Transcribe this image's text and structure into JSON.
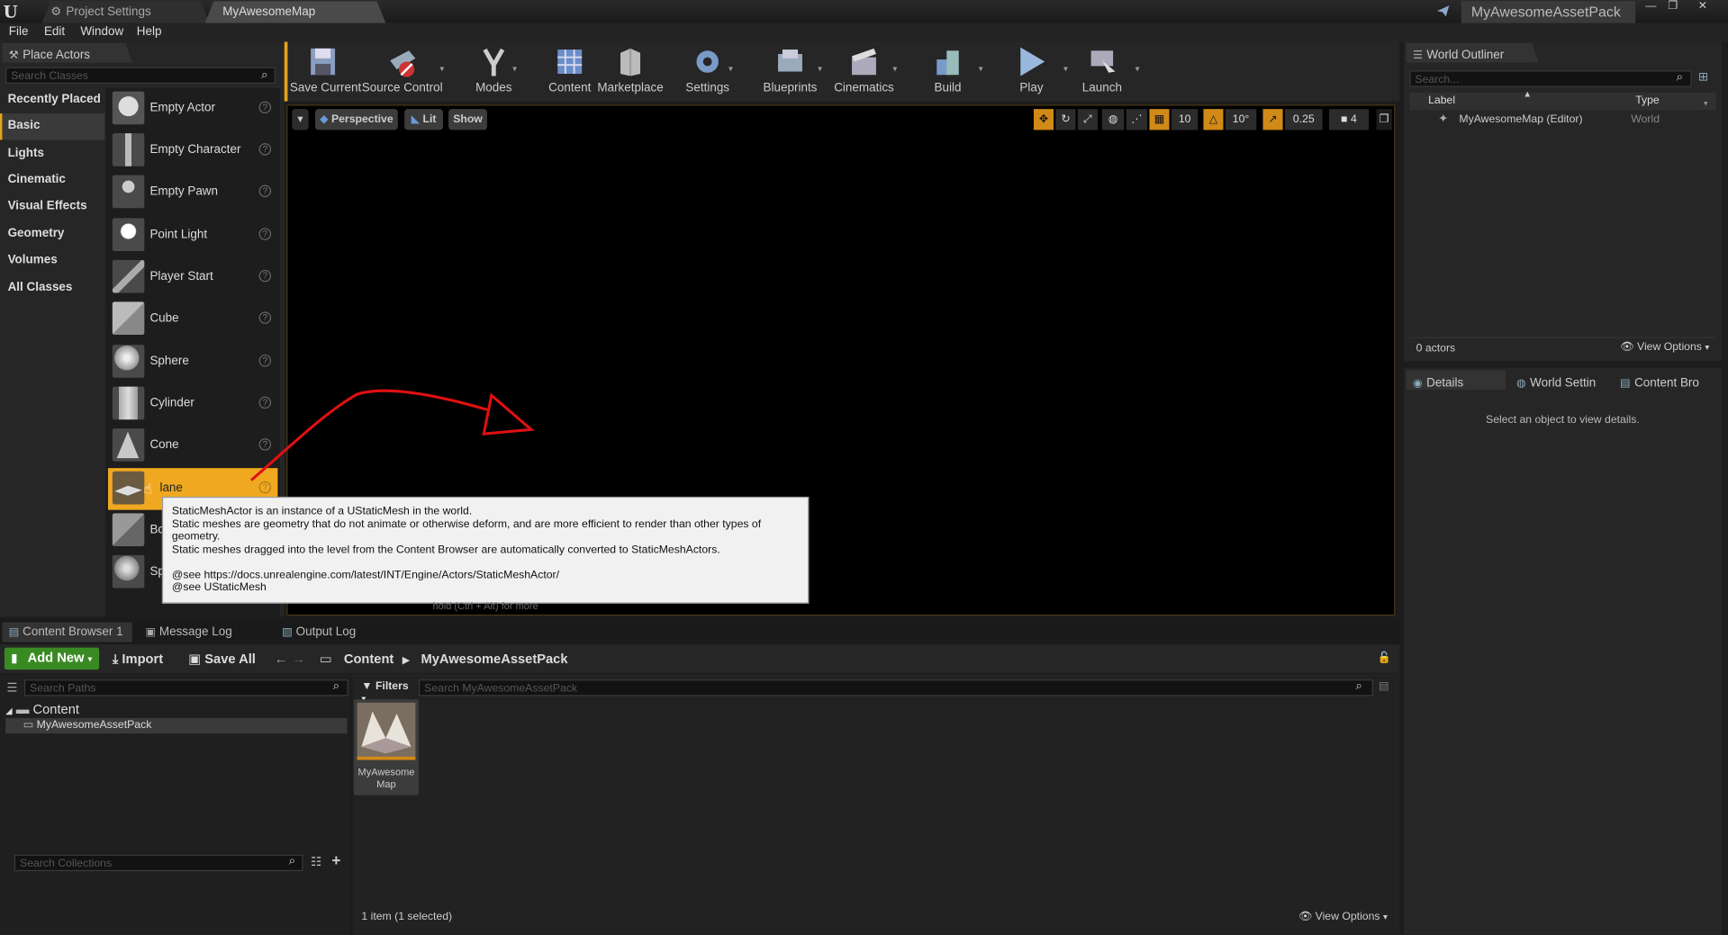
{
  "window": {
    "tabs": [
      "Project Settings",
      "MyAwesomeMap"
    ],
    "app_title": "MyAwesomeAssetPack",
    "controls": [
      "minimize",
      "restore",
      "close"
    ]
  },
  "menu": [
    "File",
    "Edit",
    "Window",
    "Help"
  ],
  "place_actors": {
    "tab_label": "Place Actors",
    "search_placeholder": "Search Classes",
    "categories": [
      "Recently Placed",
      "Basic",
      "Lights",
      "Cinematic",
      "Visual Effects",
      "Geometry",
      "Volumes",
      "All Classes"
    ],
    "selected_category": "Basic",
    "items": [
      "Empty Actor",
      "Empty Character",
      "Empty Pawn",
      "Point Light",
      "Player Start",
      "Cube",
      "Sphere",
      "Cylinder",
      "Cone",
      "Plane",
      "Box Trigger",
      "Sphere Trigger"
    ],
    "hovered_item": "Plane",
    "visible_labels": [
      "Empty Actor",
      "Empty Character",
      "Empty Pawn",
      "Point Light",
      "Player Start",
      "Cube",
      "Sphere",
      "Cylinder",
      "Cone",
      "lane",
      "Bo",
      "Sp"
    ]
  },
  "toolbar": {
    "buttons": [
      "Save Current",
      "Source Control",
      "Modes",
      "Content",
      "Marketplace",
      "Settings",
      "Blueprints",
      "Cinematics",
      "Build",
      "Play",
      "Launch"
    ]
  },
  "viewport": {
    "perspective": "Perspective",
    "lit": "Lit",
    "show": "Show",
    "grid_snap": "10",
    "rotation_snap": "10°",
    "scale_snap": "0.25",
    "camera_speed": "4",
    "annotation_color": "#e01010"
  },
  "tooltip": {
    "lines": [
      "StaticMeshActor is an instance of a UStaticMesh in the world.",
      "Static meshes are geometry that do not animate or otherwise deform, and are more efficient to render than other types of geometry.",
      "Static meshes dragged into the level from the Content Browser are automatically converted to StaticMeshActors.",
      "",
      "@see https://docs.unrealengine.com/latest/INT/Engine/Actors/StaticMeshActor/",
      "@see UStaticMesh"
    ],
    "hint": "hold (Ctrl + Alt) for more"
  },
  "world_outliner": {
    "tab_label": "World Outliner",
    "search_placeholder": "Search...",
    "col_label": "Label",
    "col_type": "Type",
    "rows": [
      {
        "label": "MyAwesomeMap (Editor)",
        "type": "World"
      }
    ],
    "actor_count": "0 actors",
    "view_options": "View Options"
  },
  "details": {
    "tabs": [
      "Details",
      "World Settin",
      "Content Bro"
    ],
    "empty_text": "Select an object to view details."
  },
  "bottom_tabs": [
    "Content Browser 1",
    "Message Log",
    "Output Log"
  ],
  "content_browser": {
    "add_new": "Add New",
    "import": "Import",
    "save_all": "Save All",
    "breadcrumb": [
      "Content",
      "MyAwesomeAssetPack"
    ],
    "search_paths_placeholder": "Search Paths",
    "filters": "Filters",
    "search_assets_placeholder": "Search MyAwesomeAssetPack",
    "tree": [
      "Content",
      "MyAwesomeAssetPack"
    ],
    "search_collections_placeholder": "Search Collections",
    "assets": [
      {
        "name_line1": "MyAwesome",
        "name_line2": "Map"
      }
    ],
    "status": "1 item (1 selected)",
    "view_options": "View Options"
  },
  "colors": {
    "accent_orange": "#e3a21a",
    "add_new_green": "#3a8a23",
    "selection_orange": "#f0a820"
  }
}
